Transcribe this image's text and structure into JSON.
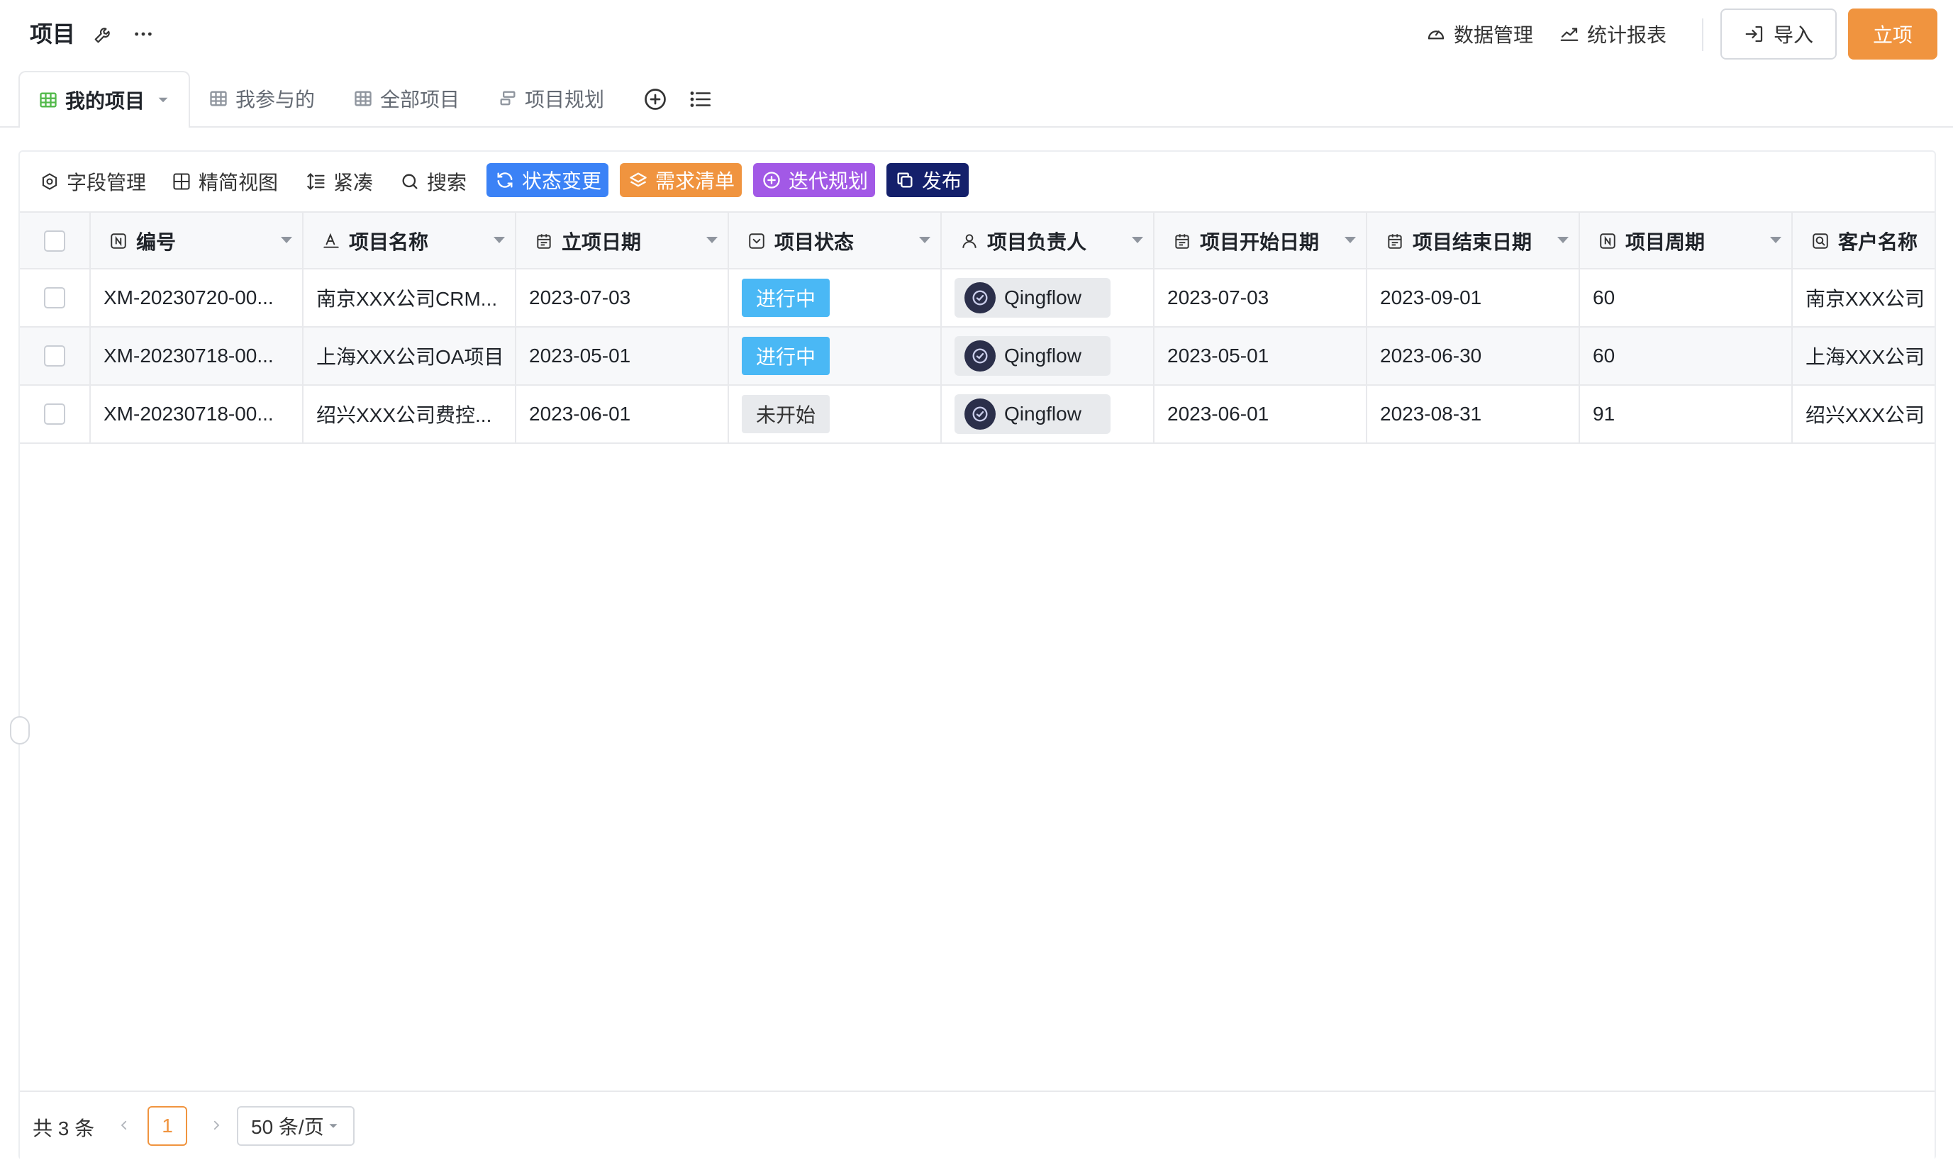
{
  "header": {
    "title": "项目",
    "links": [
      {
        "label": "数据管理",
        "icon": "dashboard-icon"
      },
      {
        "label": "统计报表",
        "icon": "trend-chart-icon"
      }
    ],
    "import_label": "导入",
    "primary_label": "立项"
  },
  "tabs": [
    {
      "label": "我的项目",
      "icon": "grid-table-icon",
      "active": true
    },
    {
      "label": "我参与的",
      "icon": "grid-table-icon"
    },
    {
      "label": "全部项目",
      "icon": "grid-table-icon"
    },
    {
      "label": "项目规划",
      "icon": "gantt-icon"
    }
  ],
  "toolbar": {
    "field_manage": "字段管理",
    "simple_view": "精简视图",
    "compact": "紧凑",
    "search": "搜索",
    "actions": [
      {
        "label": "状态变更",
        "color": "#3b82f6",
        "icon": "refresh-icon"
      },
      {
        "label": "需求清单",
        "color": "#f0943f",
        "icon": "layers-icon"
      },
      {
        "label": "迭代规划",
        "color": "#a259e6",
        "icon": "plus-circle-icon"
      },
      {
        "label": "发布",
        "color": "#14206b",
        "icon": "copy-icon"
      }
    ]
  },
  "table": {
    "columns": [
      {
        "label": "编号",
        "icon": "number-field-icon"
      },
      {
        "label": "项目名称",
        "icon": "text-field-icon"
      },
      {
        "label": "立项日期",
        "icon": "calendar-icon"
      },
      {
        "label": "项目状态",
        "icon": "select-field-icon"
      },
      {
        "label": "项目负责人",
        "icon": "user-icon"
      },
      {
        "label": "项目开始日期",
        "icon": "calendar-icon"
      },
      {
        "label": "项目结束日期",
        "icon": "calendar-icon"
      },
      {
        "label": "项目周期",
        "icon": "number-field-icon"
      },
      {
        "label": "客户名称",
        "icon": "lookup-field-icon"
      }
    ],
    "rows": [
      {
        "id": "XM-20230720-00...",
        "name": "南京XXX公司CRM...",
        "approval_date": "2023-07-03",
        "status": "进行中",
        "status_color": "#4ab8f5",
        "owner": "Qingflow",
        "start": "2023-07-03",
        "end": "2023-09-01",
        "cycle": "60",
        "customer": "南京XXX公司"
      },
      {
        "id": "XM-20230718-00...",
        "name": "上海XXX公司OA项目",
        "approval_date": "2023-05-01",
        "status": "进行中",
        "status_color": "#4ab8f5",
        "owner": "Qingflow",
        "start": "2023-05-01",
        "end": "2023-06-30",
        "cycle": "60",
        "customer": "上海XXX公司"
      },
      {
        "id": "XM-20230718-00...",
        "name": "绍兴XXX公司费控...",
        "approval_date": "2023-06-01",
        "status": "未开始",
        "status_color": "#e8eaed",
        "owner": "Qingflow",
        "start": "2023-06-01",
        "end": "2023-08-31",
        "cycle": "91",
        "customer": "绍兴XXX公司"
      }
    ]
  },
  "footer": {
    "total": "共 3 条",
    "current_page": "1",
    "page_size": "50 条/页"
  },
  "colors": {
    "primary": "#f0943f",
    "status_in_progress": "#4ab8f5",
    "status_not_started": "#e8eaed"
  }
}
